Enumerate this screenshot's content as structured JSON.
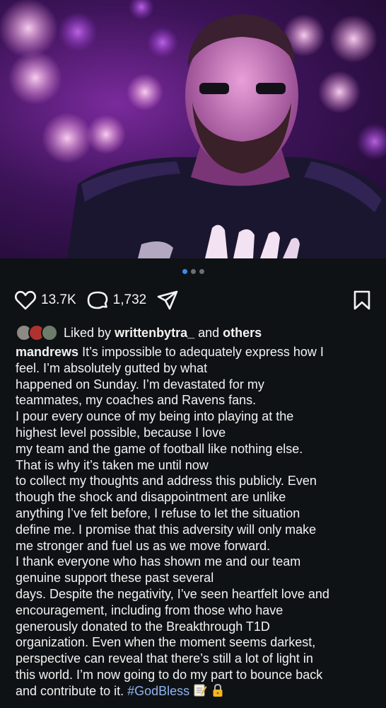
{
  "post": {
    "media": {
      "slide_count": 3,
      "active_slide": 1
    },
    "actions": {
      "likes_count": "13.7K",
      "comments_count": "1,732"
    },
    "liked_by": {
      "prefix": "Liked by",
      "user": "writtenbytra_",
      "connector": "and",
      "others": "others"
    },
    "caption": {
      "username": "mandrews",
      "paragraphs": [
        "It’s impossible to adequately express how I\nfeel. I’m absolutely gutted by what",
        "happened on Sunday. I’m devastated for my\nteammates, my coaches and Ravens fans.",
        "I pour every ounce of my being into playing at the\nhighest level possible, because I love",
        "my team and the game of football like nothing else.\nThat is why it’s taken me until now",
        "to collect my thoughts and address this publicly. Even\nthough the shock and disappointment are unlike\nanything I’ve felt before, I refuse to let the situation\ndefine me. I promise that this adversity will only make\nme stronger and fuel us as we move forward.",
        "I thank everyone who has shown me and our team\ngenuine support these past several",
        "days. Despite the negativity, I’ve seen heartfelt love and\nencouragement, including from those who have\ngenerously donated to the Breakthrough T1D\norganization. Even when the moment seems darkest,\nperspective can reveal that there’s still a lot of light in\nthis world. I’m now going to do my part to bounce back\nand contribute to it."
      ],
      "hashtag": "#GodBless"
    }
  },
  "colors": {
    "background": "#0f1214",
    "text": "#f4f4f4",
    "dot_active": "#3b8cf2",
    "dot_inactive": "#6b6f73",
    "hashtag": "#8fb4f0"
  },
  "icons": [
    "heart-icon",
    "comment-icon",
    "share-icon",
    "bookmark-icon",
    "memo-emoji-icon",
    "lock-emoji-icon"
  ]
}
